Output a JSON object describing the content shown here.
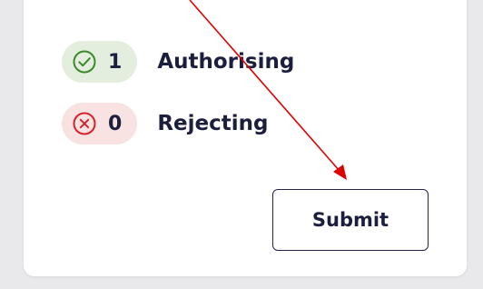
{
  "summary": {
    "authorising": {
      "count": "1",
      "label": "Authorising",
      "icon": "check-circle-icon",
      "color": "#3a8a2a"
    },
    "rejecting": {
      "count": "0",
      "label": "Rejecting",
      "icon": "x-circle-icon",
      "color": "#d4242b"
    }
  },
  "actions": {
    "submit_label": "Submit"
  },
  "annotation": {
    "color": "#e00000"
  }
}
